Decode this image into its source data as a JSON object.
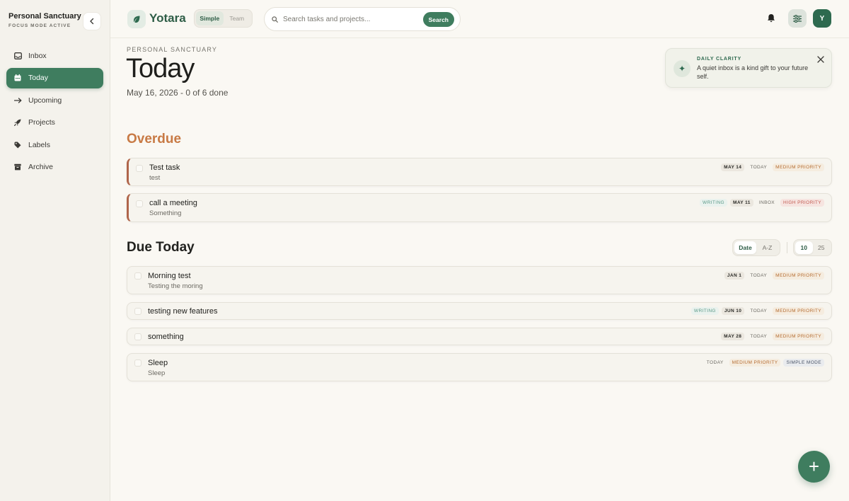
{
  "sidebar": {
    "workspace_title": "Personal Sanctuary",
    "workspace_status": "FOCUS MODE ACTIVE",
    "items": [
      {
        "label": "Inbox",
        "icon": "inbox-icon"
      },
      {
        "label": "Today",
        "icon": "calendar-icon",
        "active": true
      },
      {
        "label": "Upcoming",
        "icon": "arrow-right-icon"
      },
      {
        "label": "Projects",
        "icon": "rocket-icon"
      },
      {
        "label": "Labels",
        "icon": "tag-icon"
      },
      {
        "label": "Archive",
        "icon": "archive-icon"
      }
    ]
  },
  "header": {
    "app_name": "Yotara",
    "modes": [
      "Simple",
      "Team"
    ],
    "search_placeholder": "Search tasks and projects...",
    "search_button": "Search",
    "avatar_initial": "Y"
  },
  "main": {
    "eyebrow": "PERSONAL SANCTUARY",
    "title": "Today",
    "date_line": "May 16, 2026 - 0 of 6 done"
  },
  "tip": {
    "title": "DAILY CLARITY",
    "text": "A quiet inbox is a kind gift to your future self."
  },
  "overdue": {
    "title": "Overdue",
    "tasks": [
      {
        "title": "Test task",
        "desc": "test",
        "tags": [
          "MAY 14",
          "TODAY",
          "MEDIUM PRIORITY"
        ]
      },
      {
        "title": "call a meeting",
        "desc": "Something",
        "tags": [
          "WRITING",
          "MAY 11",
          "INBOX",
          "HIGH PRIORITY"
        ]
      }
    ]
  },
  "due_today": {
    "title": "Due Today",
    "sort_options": [
      "Date",
      "A-Z"
    ],
    "count_options": [
      "10",
      "25"
    ],
    "tasks": [
      {
        "title": "Morning test",
        "desc": "Testing the moring",
        "tags": [
          "JAN 1",
          "TODAY",
          "MEDIUM PRIORITY"
        ]
      },
      {
        "title": "testing new features",
        "desc": "",
        "tags": [
          "WRITING",
          "JUN 10",
          "TODAY",
          "MEDIUM PRIORITY"
        ]
      },
      {
        "title": "something",
        "desc": "",
        "tags": [
          "MAY 28",
          "TODAY",
          "MEDIUM PRIORITY"
        ]
      },
      {
        "title": "Sleep",
        "desc": "Sleep",
        "tags": [
          "TODAY",
          "MEDIUM PRIORITY",
          "SIMPLE MODE"
        ]
      }
    ]
  },
  "fab_label": "+",
  "colors": {
    "accent": "#3f7d5f",
    "overdue": "#c87a45",
    "medium_priority": "#b56d32",
    "high_priority": "#c25b51"
  }
}
